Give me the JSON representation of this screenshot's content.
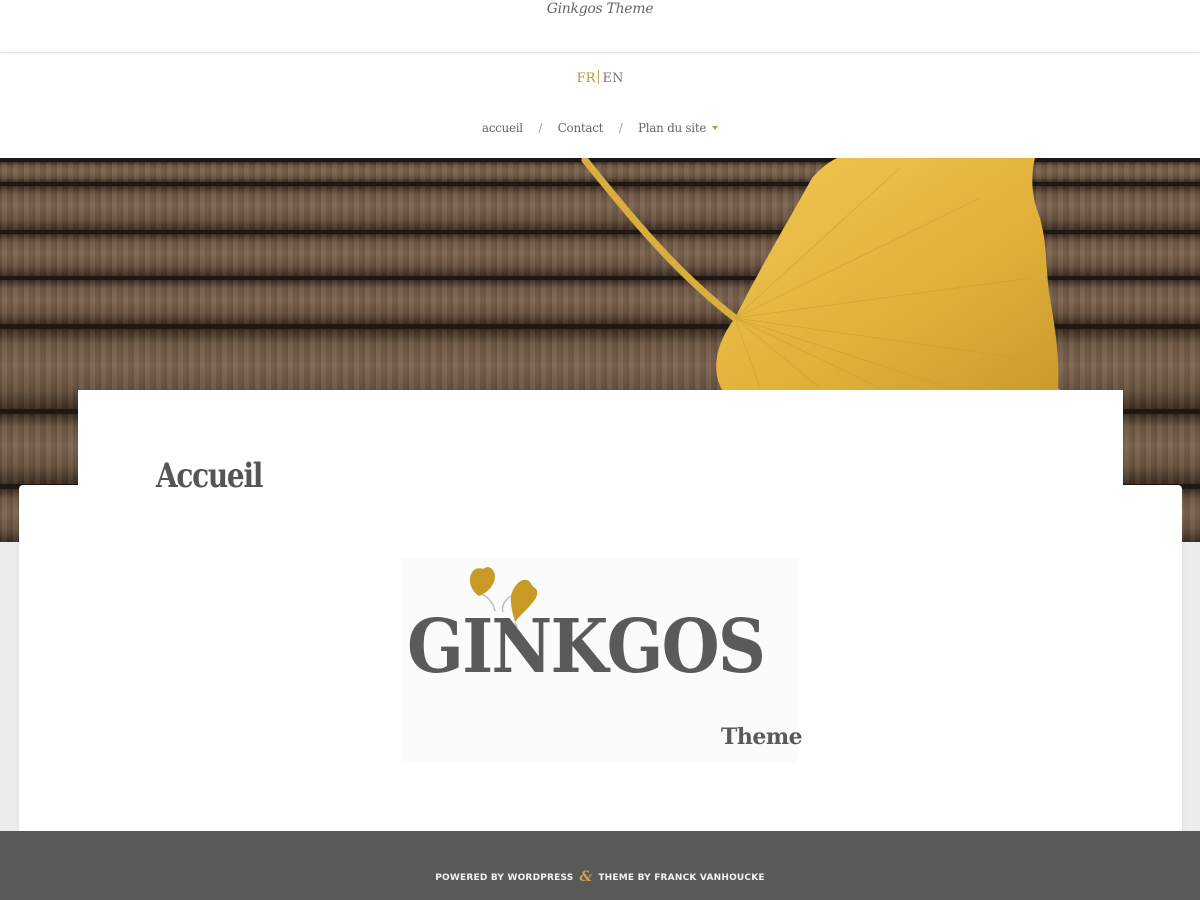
{
  "header": {
    "site_title": "Ginkgos Theme"
  },
  "language_switcher": {
    "fr": "FR",
    "en": "EN",
    "active": "FR"
  },
  "menu": {
    "items": [
      {
        "label": "accueil"
      },
      {
        "label": "Contact"
      },
      {
        "label": "Plan du site",
        "has_submenu": true
      }
    ],
    "divider": "/"
  },
  "hero": {
    "image": "wooden-planks-with-yellow-ginkgo-leaf"
  },
  "content": {
    "page_title": "Accueil",
    "logo": {
      "word": "GINKGOS",
      "sub": "Theme",
      "icon": "ginkgo-leaf-icon"
    }
  },
  "footer": {
    "powered_by": "POWERED BY WORDPRESS",
    "separator": "&",
    "theme_by": "THEME BY FRANCK VANHOUCKE"
  },
  "colors": {
    "accent": "#b8963a",
    "leaf": "#e2b33a",
    "footer_bg": "#595959",
    "text": "#555555"
  }
}
